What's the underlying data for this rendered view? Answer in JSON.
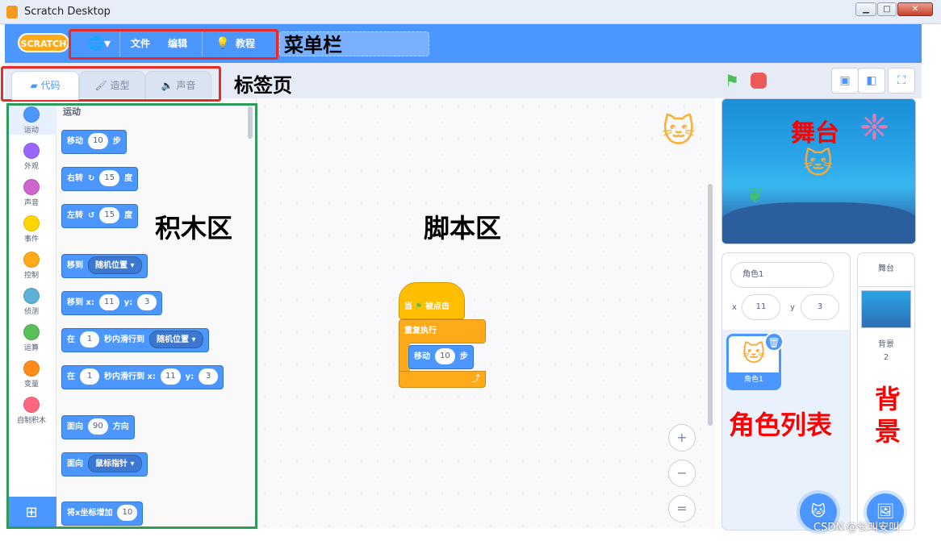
{
  "window": {
    "title": "Scratch Desktop",
    "min": "▁",
    "max": "□",
    "close": "✕"
  },
  "menubar": {
    "logo_text": "SCRATCH",
    "items": [
      {
        "label": "文件"
      },
      {
        "label": "编辑"
      },
      {
        "label": "教程"
      }
    ]
  },
  "tabs": [
    {
      "label": "代码"
    },
    {
      "label": "造型"
    },
    {
      "label": "声音"
    }
  ],
  "categories": [
    {
      "label": "运动",
      "color": "#4c97ff"
    },
    {
      "label": "外观",
      "color": "#9966ff"
    },
    {
      "label": "声音",
      "color": "#cf63cf"
    },
    {
      "label": "事件",
      "color": "#ffd500"
    },
    {
      "label": "控制",
      "color": "#ffab19"
    },
    {
      "label": "侦测",
      "color": "#5cb1d6"
    },
    {
      "label": "运算",
      "color": "#59c059"
    },
    {
      "label": "变量",
      "color": "#ff8c1a"
    },
    {
      "label": "自制积木",
      "color": "#ff6680"
    }
  ],
  "palette": {
    "section_title": "运动",
    "blocks": {
      "move": {
        "a": "移动",
        "v": "10",
        "b": "步"
      },
      "turn_right": {
        "a": "右转",
        "icon": "↻",
        "v": "15",
        "b": "度"
      },
      "turn_left": {
        "a": "左转",
        "icon": "↺",
        "v": "15",
        "b": "度"
      },
      "goto": {
        "a": "移到",
        "dd": "随机位置 ▾"
      },
      "goto_xy": {
        "a": "移到 x:",
        "x": "11",
        "ylab": "y:",
        "y": "3"
      },
      "glide": {
        "a": "在",
        "v": "1",
        "b": "秒内滑行到",
        "dd": "随机位置 ▾"
      },
      "glide_xy": {
        "a": "在",
        "v": "1",
        "b": "秒内滑行到 x:",
        "x": "11",
        "ylab": "y:",
        "y": "3"
      },
      "point_dir": {
        "a": "面向",
        "v": "90",
        "b": "方向"
      },
      "point_towards": {
        "a": "面向",
        "dd": "鼠标指针 ▾"
      },
      "change_x": {
        "a": "将x坐标增加",
        "v": "10"
      }
    }
  },
  "script": {
    "hat": {
      "a": "当",
      "b": "被点击"
    },
    "forever": "重复执行",
    "move": {
      "a": "移动",
      "v": "10",
      "b": "步"
    }
  },
  "zoom": {
    "in": "+",
    "out": "−",
    "reset": "="
  },
  "sprite": {
    "name": "角色1",
    "x_label": "x",
    "x": "11",
    "y_label": "y",
    "y": "3",
    "thumb_label": "角色1"
  },
  "backdrop": {
    "header": "舞台",
    "label": "背景",
    "count": "2"
  },
  "annotations": {
    "menubar": "菜单栏",
    "tabs": "标签页",
    "blocks": "积木区",
    "script": "脚本区",
    "stage": "舞台",
    "sprites": "角色列表",
    "backdrop": "背景"
  },
  "watermark": "CSDN @长叫安叫",
  "colors": {
    "accent": "#4c97ff",
    "annotation_red": "#ff0000",
    "annotation_green": "#2e9b5a"
  }
}
